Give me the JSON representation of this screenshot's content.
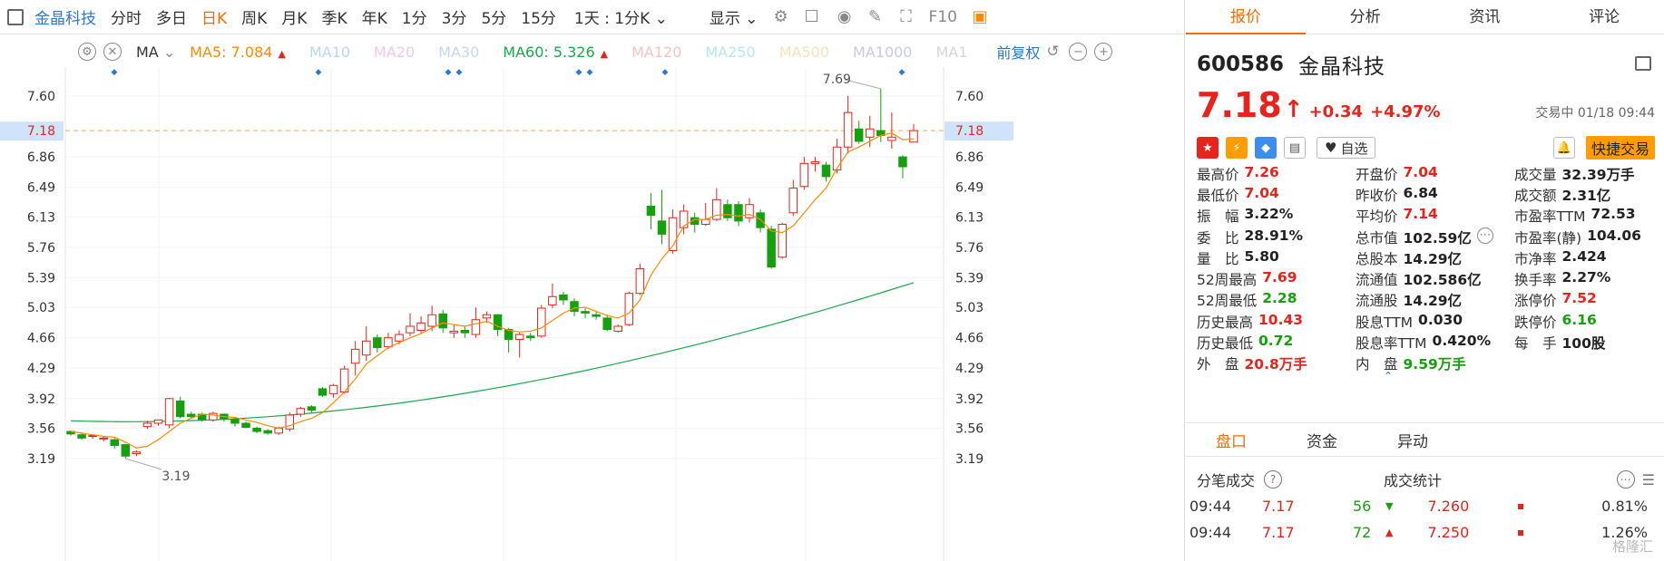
{
  "toolbar": {
    "stock_name": "金晶科技",
    "items": [
      "分时",
      "多日",
      "日K",
      "周K",
      "月K",
      "季K",
      "年K",
      "1分",
      "3分",
      "5分",
      "15分"
    ],
    "active_index": 2,
    "interval_label": "1天 : 1分K",
    "display_label": "显示",
    "f10_label": "F10"
  },
  "ma_bar": {
    "ma_label": "MA",
    "items": [
      {
        "text": "MA5: 7.084",
        "color": "#ff8a00",
        "arrow": "▲"
      },
      {
        "text": "MA10",
        "color": "#b7d8f6",
        "arrow": ""
      },
      {
        "text": "MA20",
        "color": "#f2c6ee",
        "arrow": ""
      },
      {
        "text": "MA30",
        "color": "#c9d7ee",
        "arrow": ""
      },
      {
        "text": "MA60: 5.326",
        "color": "#1aa84b",
        "arrow": "▲"
      },
      {
        "text": "MA120",
        "color": "#f6c3c3",
        "arrow": ""
      },
      {
        "text": "MA250",
        "color": "#b6e6f7",
        "arrow": ""
      },
      {
        "text": "MA500",
        "color": "#f6e4b7",
        "arrow": ""
      },
      {
        "text": "MA1000",
        "color": "#c9c9ef",
        "arrow": ""
      },
      {
        "text": "MA1",
        "color": "#d6d6d6",
        "arrow": ""
      }
    ],
    "fq_label": "前复权"
  },
  "chart_data": {
    "type": "candlestick",
    "y_ticks": [
      3.19,
      3.56,
      3.92,
      4.29,
      4.66,
      5.03,
      5.39,
      5.76,
      6.13,
      6.49,
      6.86,
      7.18,
      7.6
    ],
    "current_price_label": "7.18",
    "high_label": "7.69",
    "low_label": "3.19",
    "candles": [
      [
        3.52,
        3.49,
        3.53,
        3.47
      ],
      [
        3.48,
        3.44,
        3.5,
        3.42
      ],
      [
        3.46,
        3.47,
        3.48,
        3.43
      ],
      [
        3.43,
        3.44,
        3.46,
        3.4
      ],
      [
        3.42,
        3.35,
        3.44,
        3.31
      ],
      [
        3.36,
        3.22,
        3.37,
        3.19
      ],
      [
        3.25,
        3.27,
        3.29,
        3.22
      ],
      [
        3.58,
        3.62,
        3.65,
        3.55
      ],
      [
        3.62,
        3.66,
        3.66,
        3.59
      ],
      [
        3.6,
        3.92,
        3.93,
        3.56
      ],
      [
        3.89,
        3.7,
        3.94,
        3.68
      ],
      [
        3.73,
        3.7,
        3.76,
        3.67
      ],
      [
        3.73,
        3.66,
        3.75,
        3.64
      ],
      [
        3.66,
        3.74,
        3.76,
        3.64
      ],
      [
        3.73,
        3.67,
        3.74,
        3.64
      ],
      [
        3.67,
        3.62,
        3.69,
        3.58
      ],
      [
        3.62,
        3.57,
        3.64,
        3.56
      ],
      [
        3.56,
        3.52,
        3.58,
        3.5
      ],
      [
        3.53,
        3.5,
        3.55,
        3.48
      ],
      [
        3.5,
        3.56,
        3.58,
        3.48
      ],
      [
        3.55,
        3.72,
        3.75,
        3.52
      ],
      [
        3.73,
        3.8,
        3.82,
        3.7
      ],
      [
        3.82,
        3.78,
        3.84,
        3.75
      ],
      [
        4.04,
        3.96,
        4.06,
        3.94
      ],
      [
        3.98,
        4.08,
        4.1,
        3.93
      ],
      [
        4.0,
        4.28,
        4.32,
        3.98
      ],
      [
        4.35,
        4.52,
        4.62,
        4.2
      ],
      [
        4.45,
        4.62,
        4.8,
        4.38
      ],
      [
        4.66,
        4.54,
        4.7,
        4.48
      ],
      [
        4.55,
        4.66,
        4.72,
        4.52
      ],
      [
        4.62,
        4.7,
        4.75,
        4.58
      ],
      [
        4.72,
        4.8,
        4.96,
        4.68
      ],
      [
        4.75,
        4.84,
        4.92,
        4.72
      ],
      [
        4.8,
        4.94,
        5.05,
        4.74
      ],
      [
        4.95,
        4.78,
        5.0,
        4.72
      ],
      [
        4.72,
        4.74,
        4.82,
        4.66
      ],
      [
        4.75,
        4.72,
        4.8,
        4.66
      ],
      [
        4.7,
        4.88,
        5.03,
        4.66
      ],
      [
        4.9,
        4.94,
        4.98,
        4.84
      ],
      [
        4.94,
        4.76,
        4.95,
        4.68
      ],
      [
        4.76,
        4.64,
        4.78,
        4.48
      ],
      [
        4.64,
        4.7,
        4.72,
        4.42
      ],
      [
        4.68,
        4.66,
        4.72,
        4.62
      ],
      [
        4.68,
        5.02,
        5.06,
        4.66
      ],
      [
        5.06,
        5.16,
        5.32,
        5.02
      ],
      [
        5.18,
        5.12,
        5.22,
        5.06
      ],
      [
        5.1,
        4.98,
        5.14,
        4.92
      ],
      [
        4.98,
        4.96,
        5.02,
        4.9
      ],
      [
        4.94,
        4.92,
        4.98,
        4.88
      ],
      [
        4.9,
        4.76,
        4.94,
        4.74
      ],
      [
        4.74,
        4.8,
        4.82,
        4.72
      ],
      [
        4.82,
        5.2,
        5.22,
        4.8
      ],
      [
        5.2,
        5.5,
        5.56,
        5.18
      ],
      [
        6.26,
        6.15,
        6.42,
        5.98
      ],
      [
        6.08,
        5.92,
        6.46,
        5.8
      ],
      [
        5.72,
        6.12,
        6.22,
        5.68
      ],
      [
        6.0,
        6.2,
        6.28,
        5.92
      ],
      [
        6.12,
        6.04,
        6.18,
        5.94
      ],
      [
        6.04,
        6.1,
        6.3,
        6.02
      ],
      [
        6.1,
        6.34,
        6.48,
        6.08
      ],
      [
        6.28,
        6.12,
        6.34,
        6.08
      ],
      [
        6.28,
        6.08,
        6.32,
        6.02
      ],
      [
        6.12,
        6.28,
        6.36,
        6.06
      ],
      [
        6.18,
        6.0,
        6.22,
        5.94
      ],
      [
        5.98,
        5.52,
        6.02,
        5.5
      ],
      [
        5.64,
        6.04,
        6.06,
        5.62
      ],
      [
        6.18,
        6.48,
        6.58,
        6.14
      ],
      [
        6.5,
        6.78,
        6.86,
        6.46
      ],
      [
        6.78,
        6.8,
        6.86,
        6.68
      ],
      [
        6.76,
        6.62,
        6.8,
        6.56
      ],
      [
        6.7,
        6.98,
        7.08,
        6.66
      ],
      [
        6.98,
        7.4,
        7.6,
        6.9
      ],
      [
        7.2,
        7.05,
        7.3,
        7.02
      ],
      [
        7.1,
        7.2,
        7.36,
        6.98
      ],
      [
        7.18,
        7.12,
        7.69,
        7.04
      ],
      [
        7.06,
        7.1,
        7.4,
        6.96
      ],
      [
        6.86,
        6.74,
        6.88,
        6.6
      ],
      [
        7.04,
        7.18,
        7.26,
        7.04
      ]
    ],
    "ma5": [
      3.52,
      3.5,
      3.48,
      3.46,
      3.45,
      3.39,
      3.32,
      3.34,
      3.42,
      3.52,
      3.62,
      3.68,
      3.73,
      3.72,
      3.7,
      3.69,
      3.66,
      3.63,
      3.59,
      3.56,
      3.59,
      3.64,
      3.68,
      3.75,
      3.87,
      4.0,
      4.16,
      4.34,
      4.44,
      4.54,
      4.6,
      4.66,
      4.71,
      4.78,
      4.84,
      4.82,
      4.8,
      4.83,
      4.86,
      4.8,
      4.75,
      4.73,
      4.74,
      4.78,
      4.87,
      4.96,
      5.02,
      5.03,
      4.98,
      4.93,
      4.9,
      4.96,
      5.12,
      5.42,
      5.62,
      5.78,
      6.02,
      6.1,
      6.1,
      6.15,
      6.16,
      6.14,
      6.16,
      6.1,
      5.96,
      5.94,
      6.02,
      6.18,
      6.34,
      6.48,
      6.72,
      6.92,
      6.98,
      7.05,
      7.12,
      7.15,
      7.07,
      7.08
    ],
    "ma60_start": 3.65,
    "ma60_end": 5.33
  },
  "panel": {
    "tabs": [
      "报价",
      "分析",
      "资讯",
      "评论"
    ],
    "active_tab": 0,
    "code": "600586",
    "name": "金晶科技",
    "price": "7.18",
    "arrow": "↑",
    "change": "+0.34",
    "change_pct": "+4.97%",
    "status": "交易中 01/18 09:44",
    "watch_label": "自选",
    "quick_trade_label": "快捷交易",
    "stats": [
      [
        {
          "lb": "最高价",
          "vl": "7.26",
          "c": "red"
        },
        {
          "lb": "开盘价",
          "vl": "7.04",
          "c": "red"
        },
        {
          "lb": "成交量",
          "vl": "32.39万手",
          "c": ""
        }
      ],
      [
        {
          "lb": "最低价",
          "vl": "7.04",
          "c": "red"
        },
        {
          "lb": "昨收价",
          "vl": "6.84",
          "c": ""
        },
        {
          "lb": "成交额",
          "vl": "2.31亿",
          "c": ""
        }
      ],
      [
        {
          "lb": "振　幅",
          "vl": "3.22%",
          "c": ""
        },
        {
          "lb": "平均价",
          "vl": "7.14",
          "c": "red"
        },
        {
          "lb": "市盈率TTM",
          "vl": "72.53",
          "c": ""
        }
      ],
      [
        {
          "lb": "委　比",
          "vl": "28.91%",
          "c": ""
        },
        {
          "lb": "总市值",
          "vl": "102.59亿",
          "c": ""
        },
        {
          "lb": "市盈率(静)",
          "vl": "104.06",
          "c": ""
        }
      ],
      [
        {
          "lb": "量　比",
          "vl": "5.80",
          "c": ""
        },
        {
          "lb": "总股本",
          "vl": "14.29亿",
          "c": ""
        },
        {
          "lb": "市净率",
          "vl": "2.424",
          "c": ""
        }
      ],
      [
        {
          "lb": "52周最高",
          "vl": "7.69",
          "c": "red"
        },
        {
          "lb": "流通值",
          "vl": "102.586亿",
          "c": ""
        },
        {
          "lb": "换手率",
          "vl": "2.27%",
          "c": ""
        }
      ],
      [
        {
          "lb": "52周最低",
          "vl": "2.28",
          "c": "green"
        },
        {
          "lb": "流通股",
          "vl": "14.29亿",
          "c": ""
        },
        {
          "lb": "涨停价",
          "vl": "7.52",
          "c": "red"
        }
      ],
      [
        {
          "lb": "历史最高",
          "vl": "10.43",
          "c": "red"
        },
        {
          "lb": "股息TTM",
          "vl": "0.030",
          "c": ""
        },
        {
          "lb": "跌停价",
          "vl": "6.16",
          "c": "green"
        }
      ],
      [
        {
          "lb": "历史最低",
          "vl": "0.72",
          "c": "green"
        },
        {
          "lb": "股息率TTM",
          "vl": "0.420%",
          "c": ""
        },
        {
          "lb": "每　手",
          "vl": "100股",
          "c": ""
        }
      ],
      [
        {
          "lb": "外　盘",
          "vl": "20.8万手",
          "c": "red"
        },
        {
          "lb": "内　盘",
          "vl": "9.59万手",
          "c": "green"
        },
        {
          "lb": "",
          "vl": "",
          "c": ""
        }
      ]
    ],
    "tabs2": [
      "盘口",
      "资金",
      "异动"
    ],
    "active_tab2": 0,
    "trade_title": "分笔成交",
    "stat_title": "成交统计",
    "trades": [
      {
        "time": "09:44",
        "price": "7.17",
        "vol": "56",
        "dir": "▼",
        "dircolor": "#15a10e"
      },
      {
        "time": "09:44",
        "price": "7.17",
        "vol": "72",
        "dir": "▲",
        "dircolor": "#e8231b"
      }
    ],
    "stat_rows": [
      {
        "price": "7.260",
        "pct": "0.81%"
      },
      {
        "price": "7.250",
        "pct": "1.26%"
      }
    ],
    "watermark": "格隆汇"
  }
}
